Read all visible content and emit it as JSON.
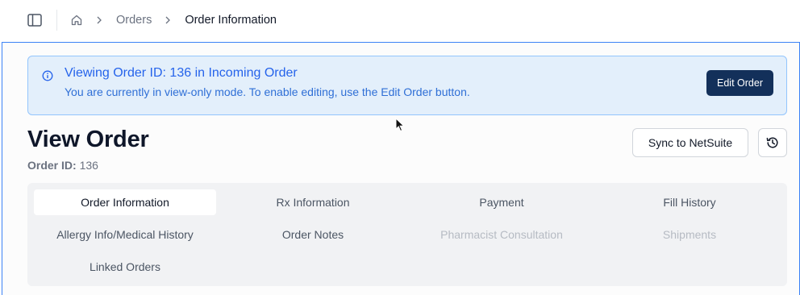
{
  "breadcrumb": {
    "items": [
      "Orders"
    ],
    "current": "Order Information"
  },
  "alert": {
    "title": "Viewing Order ID: 136 in Incoming Order",
    "message": "You are currently in view-only mode. To enable editing, use the Edit Order button.",
    "action_label": "Edit Order"
  },
  "header": {
    "title": "View Order",
    "order_id_label": "Order ID:",
    "order_id_value": "136",
    "sync_label": "Sync to NetSuite"
  },
  "tabs": [
    {
      "label": "Order Information",
      "state": "active"
    },
    {
      "label": "Rx Information",
      "state": "enabled"
    },
    {
      "label": "Payment",
      "state": "enabled"
    },
    {
      "label": "Fill History",
      "state": "enabled"
    },
    {
      "label": "Allergy Info/Medical History",
      "state": "enabled"
    },
    {
      "label": "Order Notes",
      "state": "enabled"
    },
    {
      "label": "Pharmacist Consultation",
      "state": "disabled"
    },
    {
      "label": "Shipments",
      "state": "disabled"
    },
    {
      "label": "Linked Orders",
      "state": "enabled"
    }
  ],
  "icons": {
    "sidebar_toggle": "sidebar-panel-icon",
    "home": "home-icon",
    "separator": "chevron-right-icon",
    "info": "info-circle-icon",
    "history": "history-icon",
    "cursor": "mouse-pointer-icon"
  },
  "colors": {
    "accent": "#2563eb",
    "alert_bg": "#e3effb",
    "primary_button": "#13305a",
    "panel_border": "#3b82f6"
  }
}
